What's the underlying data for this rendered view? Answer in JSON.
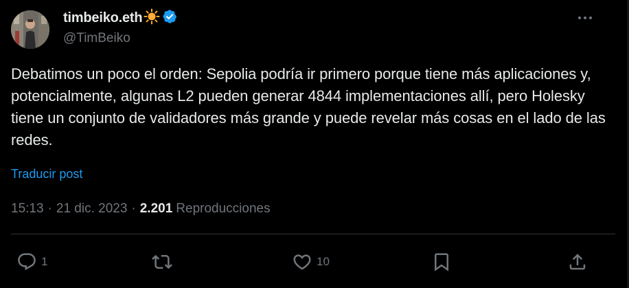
{
  "author": {
    "display_name": "timbeiko.eth",
    "handle": "@TimBeiko",
    "verified": true,
    "name_emoji": "sun-icon"
  },
  "tweet": {
    "text": "Debatimos un poco el orden: Sepolia podría ir primero porque tiene más aplicaciones y, potencialmente, algunas L2 pueden generar 4844 implementaciones allí, pero Holesky tiene un conjunto de validadores más grande y puede revelar más cosas en el lado de las redes.",
    "translate_label": "Traducir post"
  },
  "meta": {
    "time": "15:13",
    "separator": "·",
    "date": "21 dic. 2023",
    "views_count": "2.201",
    "views_label": "Reproducciones"
  },
  "actions": {
    "reply_count": "1",
    "repost_count": "",
    "like_count": "10"
  },
  "colors": {
    "background": "#000000",
    "text": "#e7e9ea",
    "muted": "#71767b",
    "link": "#1d9bf0",
    "verified": "#1d9bf0",
    "sun": "#ffac33",
    "divider": "#2f3336"
  }
}
